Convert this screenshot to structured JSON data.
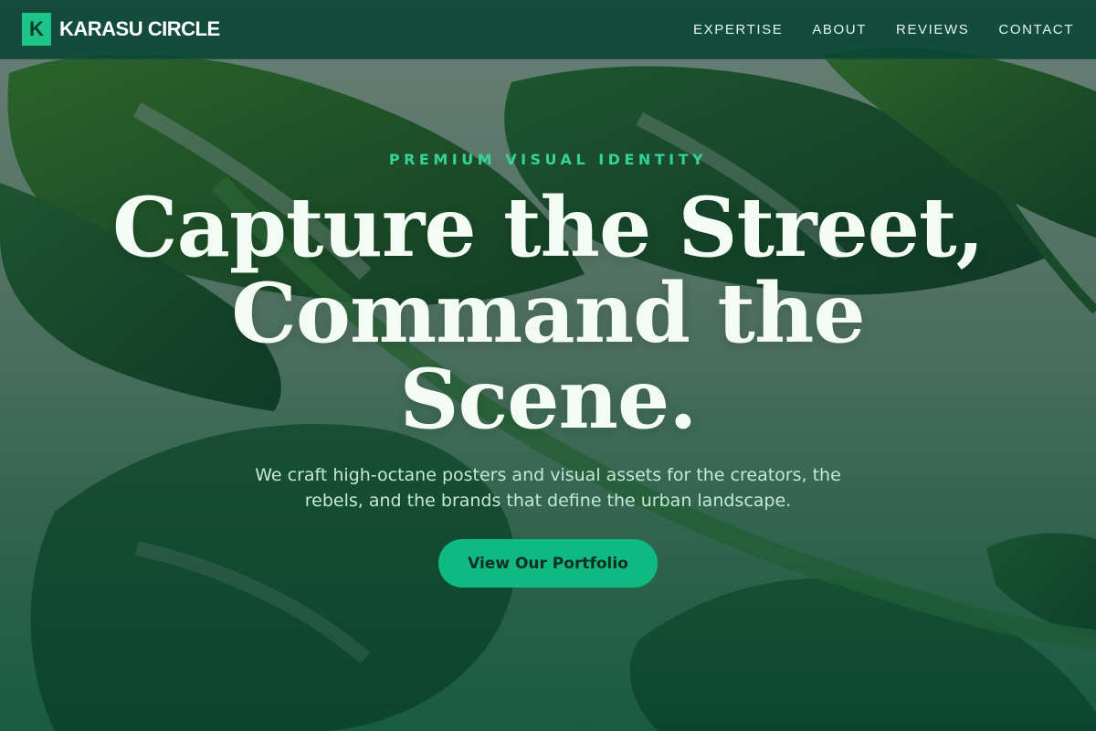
{
  "brand": {
    "mark": "K",
    "name": "KARASU CIRCLE"
  },
  "nav": {
    "links": [
      {
        "label": "EXPERTISE"
      },
      {
        "label": "ABOUT"
      },
      {
        "label": "REVIEWS"
      },
      {
        "label": "CONTACT"
      }
    ]
  },
  "hero": {
    "eyebrow": "PREMIUM VISUAL IDENTITY",
    "headline_line1": "Capture the Street,",
    "headline_line2": "Command the",
    "headline_line3": "Scene.",
    "subtitle": "We craft high-octane posters and visual assets for the creators, the rebels, and the brands that define the urban landscape.",
    "cta_label": "View Our Portfolio",
    "background_image": "monstera-leaves-photo"
  },
  "colors": {
    "accent": "#10b981",
    "eyebrow": "#34d399",
    "nav_bg": "#084634",
    "headline": "#f4fbf5"
  }
}
